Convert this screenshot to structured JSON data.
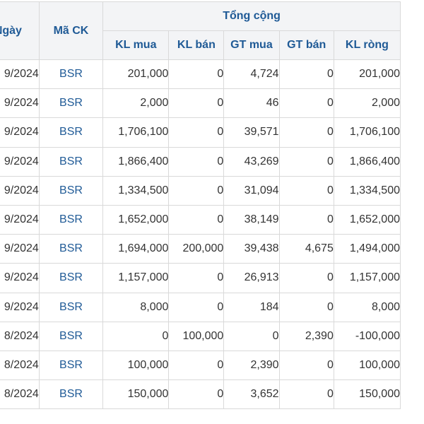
{
  "table": {
    "headers": {
      "date": "Ngày",
      "code": "Mã CK",
      "group": "Tổng cộng",
      "kl_mua": "KL mua",
      "kl_ban": "KL bán",
      "gt_mua": "GT mua",
      "gt_ban": "GT bán",
      "kl_rong": "KL ròng"
    },
    "rows": [
      {
        "date": "9/2024",
        "code": "BSR",
        "kl_mua": "201,000",
        "kl_ban": "0",
        "gt_mua": "4,724",
        "gt_ban": "0",
        "kl_rong": "201,000"
      },
      {
        "date": "9/2024",
        "code": "BSR",
        "kl_mua": "2,000",
        "kl_ban": "0",
        "gt_mua": "46",
        "gt_ban": "0",
        "kl_rong": "2,000"
      },
      {
        "date": "9/2024",
        "code": "BSR",
        "kl_mua": "1,706,100",
        "kl_ban": "0",
        "gt_mua": "39,571",
        "gt_ban": "0",
        "kl_rong": "1,706,100"
      },
      {
        "date": "9/2024",
        "code": "BSR",
        "kl_mua": "1,866,400",
        "kl_ban": "0",
        "gt_mua": "43,269",
        "gt_ban": "0",
        "kl_rong": "1,866,400"
      },
      {
        "date": "9/2024",
        "code": "BSR",
        "kl_mua": "1,334,500",
        "kl_ban": "0",
        "gt_mua": "31,094",
        "gt_ban": "0",
        "kl_rong": "1,334,500"
      },
      {
        "date": "9/2024",
        "code": "BSR",
        "kl_mua": "1,652,000",
        "kl_ban": "0",
        "gt_mua": "38,149",
        "gt_ban": "0",
        "kl_rong": "1,652,000"
      },
      {
        "date": "9/2024",
        "code": "BSR",
        "kl_mua": "1,694,000",
        "kl_ban": "200,000",
        "gt_mua": "39,438",
        "gt_ban": "4,675",
        "kl_rong": "1,494,000"
      },
      {
        "date": "9/2024",
        "code": "BSR",
        "kl_mua": "1,157,000",
        "kl_ban": "0",
        "gt_mua": "26,913",
        "gt_ban": "0",
        "kl_rong": "1,157,000"
      },
      {
        "date": "9/2024",
        "code": "BSR",
        "kl_mua": "8,000",
        "kl_ban": "0",
        "gt_mua": "184",
        "gt_ban": "0",
        "kl_rong": "8,000"
      },
      {
        "date": "8/2024",
        "code": "BSR",
        "kl_mua": "0",
        "kl_ban": "100,000",
        "gt_mua": "0",
        "gt_ban": "2,390",
        "kl_rong": "-100,000"
      },
      {
        "date": "8/2024",
        "code": "BSR",
        "kl_mua": "100,000",
        "kl_ban": "0",
        "gt_mua": "2,390",
        "gt_ban": "0",
        "kl_rong": "100,000"
      },
      {
        "date": "8/2024",
        "code": "BSR",
        "kl_mua": "150,000",
        "kl_ban": "0",
        "gt_mua": "3,652",
        "gt_ban": "0",
        "kl_rong": "150,000"
      }
    ]
  },
  "colors": {
    "header_text": "#1f5a96",
    "header_bg": "#f3f4f6",
    "border": "#d9d9d9",
    "body_text": "#333333",
    "code_text": "#1f5a96"
  }
}
